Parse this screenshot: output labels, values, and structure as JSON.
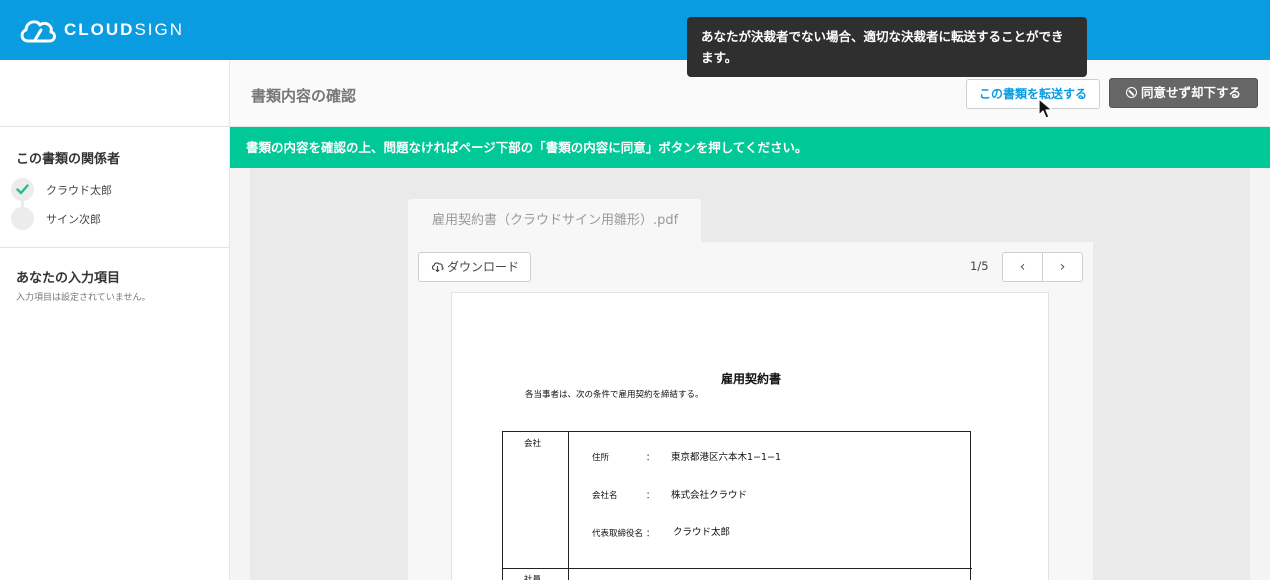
{
  "header": {
    "logo_bold": "CLOUD",
    "logo_light": "SIGN",
    "tooltip": "あなたが決裁者でない場合、適切な決裁者に転送することができます。"
  },
  "subheader": {
    "title": "書類内容の確認",
    "forward_label": "この書類を転送する",
    "reject_label": "同意せず却下する"
  },
  "sidebar": {
    "parties_title": "この書類の関係者",
    "parties": [
      {
        "name": "クラウド太郎",
        "status": "done"
      },
      {
        "name": "サイン次郎",
        "status": "pending"
      }
    ],
    "inputs_title": "あなたの入力項目",
    "inputs_note": "入力項目は設定されていません。"
  },
  "banner": "書類の内容を確認の上、問題なければページ下部の「書類の内容に同意」ボタンを押してください。",
  "document": {
    "filename": "雇用契約書（クラウドサイン用雛形）.pdf",
    "download_label": "ダウンロード",
    "page_indicator": "1/5",
    "prev_label": "‹",
    "next_label": "›",
    "title": "雇用契約書",
    "lead": "各当事者は、次の条件で雇用契約を締結する。",
    "table": {
      "section_company": "会社",
      "section_employee": "社員",
      "fields": [
        {
          "label": "住所",
          "colon": "：",
          "value": "東京都港区六本木1−1−1"
        },
        {
          "label": "会社名",
          "colon": "：",
          "value": "株式会社クラウド"
        },
        {
          "label": "代表取締役名",
          "colon": "：",
          "value": "クラウド太郎"
        }
      ]
    }
  },
  "colors": {
    "header_blue": "#0a9ce0",
    "banner_green": "#00c896",
    "check_green": "#1fbf8f",
    "tooltip_bg": "#2f2f2f"
  },
  "icons": [
    "cloud-logo-icon",
    "cursor-arrow-icon",
    "ban-icon",
    "check-icon",
    "cloud-download-icon",
    "chevron-left-icon",
    "chevron-right-icon"
  ]
}
